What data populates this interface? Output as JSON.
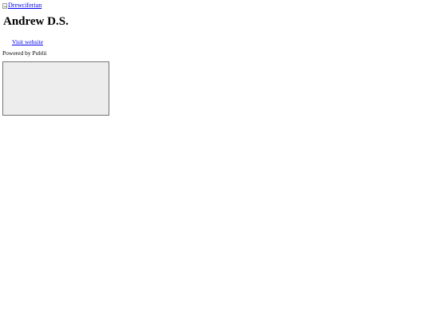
{
  "header": {
    "logo_alt_text": "Drewciferian"
  },
  "author": {
    "name": "Andrew D.S.",
    "website_link_label": "Visit website"
  },
  "footer": {
    "powered_by_text": "Powered by Publii"
  },
  "embed": {
    "content": ""
  }
}
